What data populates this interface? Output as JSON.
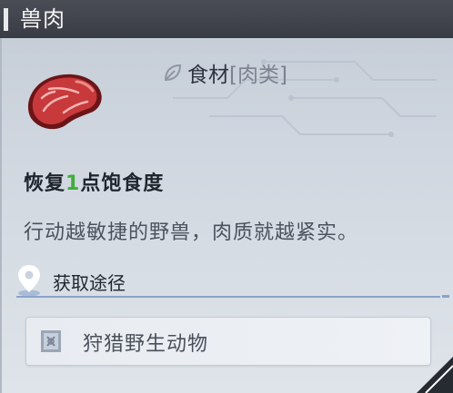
{
  "header": {
    "title": "兽肉"
  },
  "item": {
    "icon": "raw-meat-icon",
    "category_icon": "leaf-icon",
    "category": "食材",
    "subcategory": "[肉类]"
  },
  "effect": {
    "prefix": "恢复",
    "amount": "1",
    "suffix": "点饱食度",
    "highlight_color": "#3fae3a"
  },
  "description": "行动越敏捷的野兽，肉质就越紧实。",
  "source": {
    "label": "获取途径",
    "label_icon": "location-pin-icon",
    "items": [
      {
        "icon": "scroll-icon",
        "text": "狩猎野生动物"
      }
    ]
  }
}
